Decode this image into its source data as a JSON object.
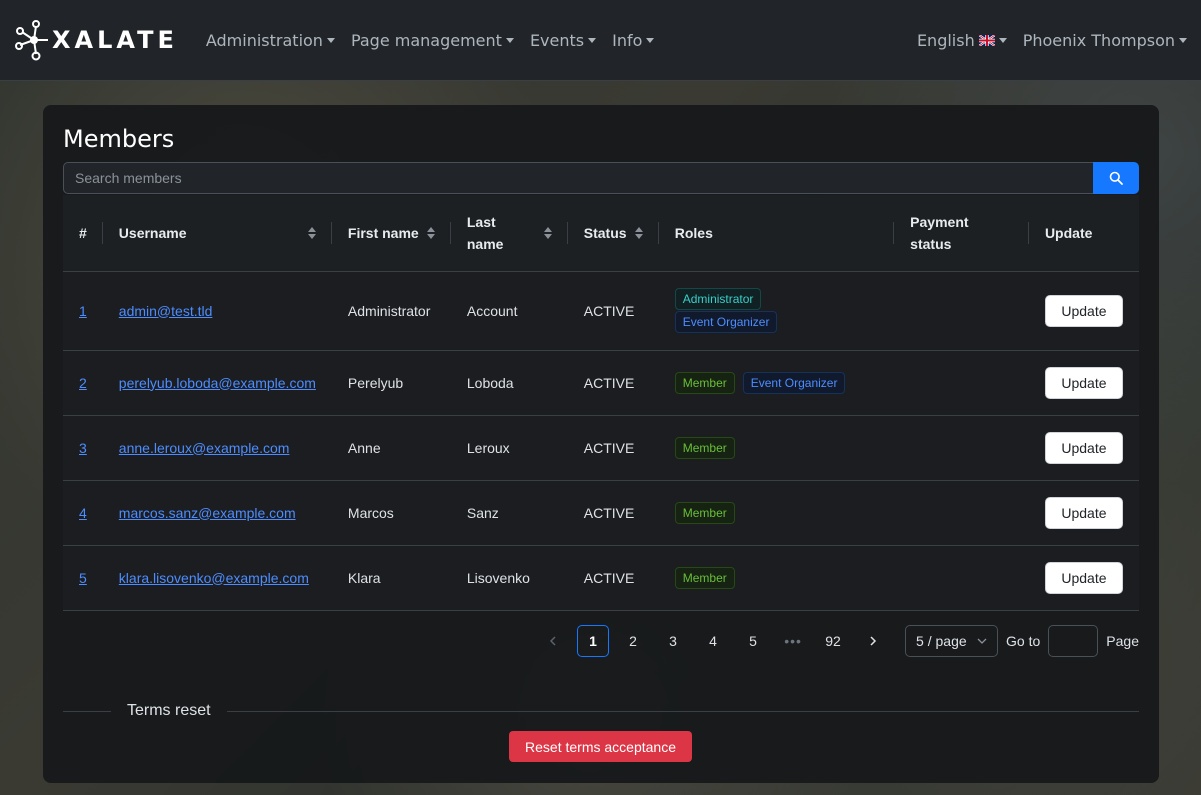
{
  "brand": {
    "name": "XALATE"
  },
  "nav": {
    "items": [
      "Administration",
      "Page management",
      "Events",
      "Info"
    ],
    "language": "English",
    "user": "Phoenix Thompson"
  },
  "page": {
    "title": "Members",
    "search_placeholder": "Search members"
  },
  "table": {
    "headers": {
      "num": "#",
      "username": "Username",
      "first_name": "First name",
      "last_name": "Last name",
      "status": "Status",
      "roles": "Roles",
      "payment": "Payment status",
      "update": "Update"
    },
    "rows": [
      {
        "id": "1",
        "username": "admin@test.tld",
        "first": "Administrator",
        "last": "Account",
        "status": "ACTIVE",
        "roles": [
          "Administrator",
          "Event Organizer"
        ],
        "payment": "",
        "update": "Update"
      },
      {
        "id": "2",
        "username": "perelyub.loboda@example.com",
        "first": "Perelyub",
        "last": "Loboda",
        "status": "ACTIVE",
        "roles": [
          "Member",
          "Event Organizer"
        ],
        "payment": "",
        "update": "Update"
      },
      {
        "id": "3",
        "username": "anne.leroux@example.com",
        "first": "Anne",
        "last": "Leroux",
        "status": "ACTIVE",
        "roles": [
          "Member"
        ],
        "payment": "",
        "update": "Update"
      },
      {
        "id": "4",
        "username": "marcos.sanz@example.com",
        "first": "Marcos",
        "last": "Sanz",
        "status": "ACTIVE",
        "roles": [
          "Member"
        ],
        "payment": "",
        "update": "Update"
      },
      {
        "id": "5",
        "username": "klara.lisovenko@example.com",
        "first": "Klara",
        "last": "Lisovenko",
        "status": "ACTIVE",
        "roles": [
          "Member"
        ],
        "payment": "",
        "update": "Update"
      }
    ]
  },
  "pagination": {
    "pages": [
      "1",
      "2",
      "3",
      "4",
      "5"
    ],
    "ellipsis": "•••",
    "last_page": "92",
    "current": "1",
    "page_size": "5 / page",
    "goto_label": "Go to",
    "page_label": "Page"
  },
  "terms": {
    "section_label": "Terms reset",
    "reset_button": "Reset terms acceptance"
  },
  "colors": {
    "primary": "#1677ff",
    "danger": "#dc3545",
    "navbar": "#212529"
  }
}
